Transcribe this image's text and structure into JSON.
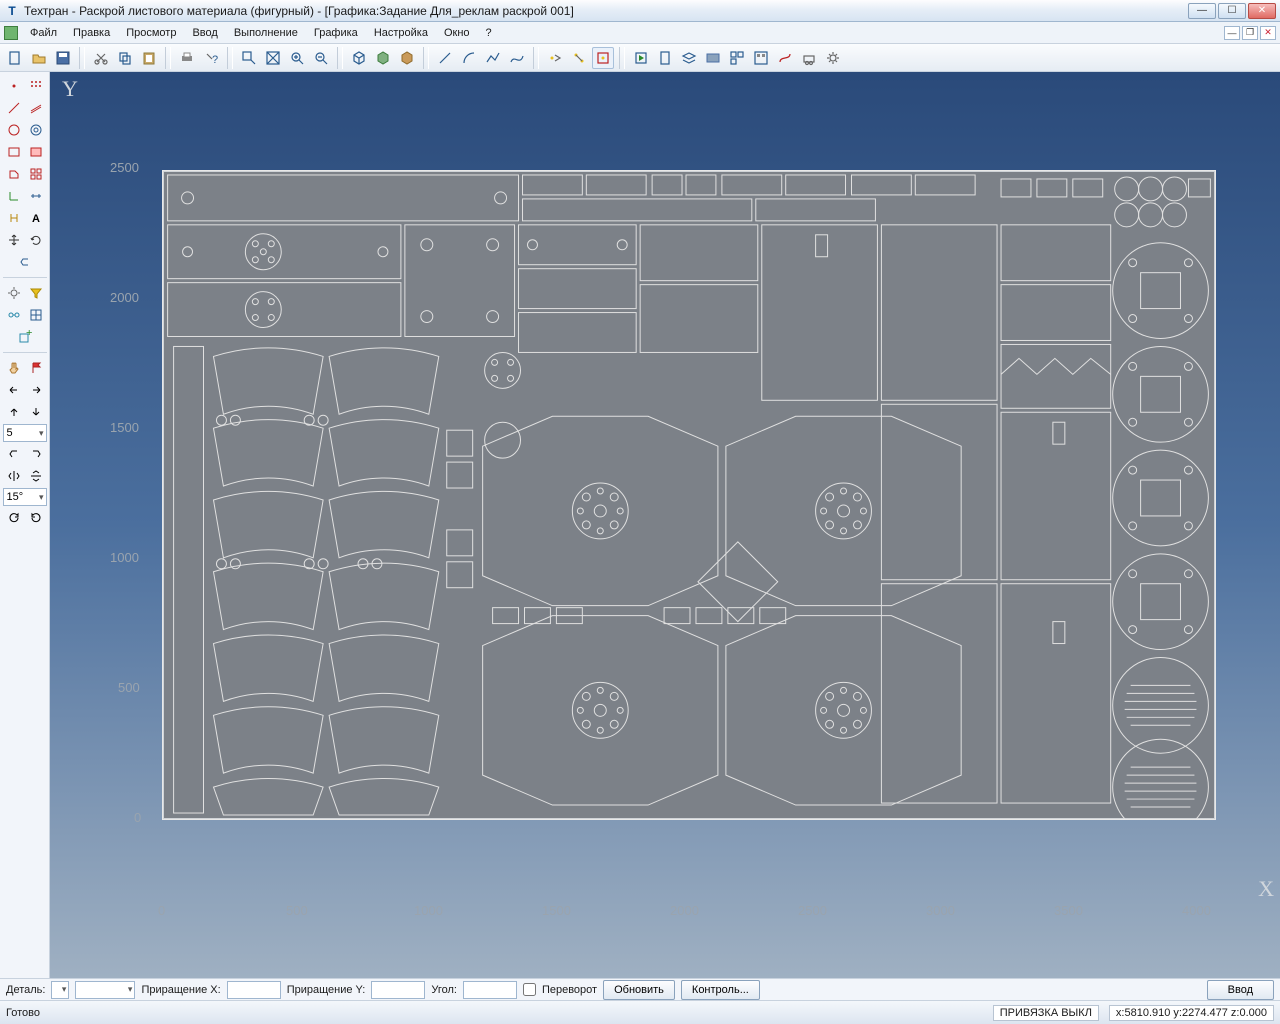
{
  "title": "Техтран - Раскрой листового материала (фигурный) - [Графика:Задание Для_реклам раскрой 001]",
  "menu": {
    "file": "Файл",
    "edit": "Правка",
    "view": "Просмотр",
    "input": "Ввод",
    "exec": "Выполнение",
    "graphics": "Графика",
    "settings": "Настройка",
    "window": "Окно",
    "help": "?"
  },
  "left_combos": {
    "step": "5",
    "angle": "15°"
  },
  "axes": {
    "x": "X",
    "y": "Y"
  },
  "y_ticks": [
    "2500",
    "2000",
    "1500",
    "1000",
    "500",
    "0"
  ],
  "x_ticks": [
    "0",
    "500",
    "1000",
    "1500",
    "2000",
    "2500",
    "3000",
    "3500",
    "4000"
  ],
  "bottom": {
    "detail_label": "Деталь:",
    "dx_label": "Приращение X:",
    "dy_label": "Приращение Y:",
    "angle_label": "Угол:",
    "flip_label": "Переворот",
    "update": "Обновить",
    "control": "Контроль...",
    "enter": "Ввод"
  },
  "status": {
    "ready": "Готово",
    "snap": "ПРИВЯЗКА ВЫКЛ",
    "coords": "x:5810.910 y:2274.477 z:0.000"
  }
}
